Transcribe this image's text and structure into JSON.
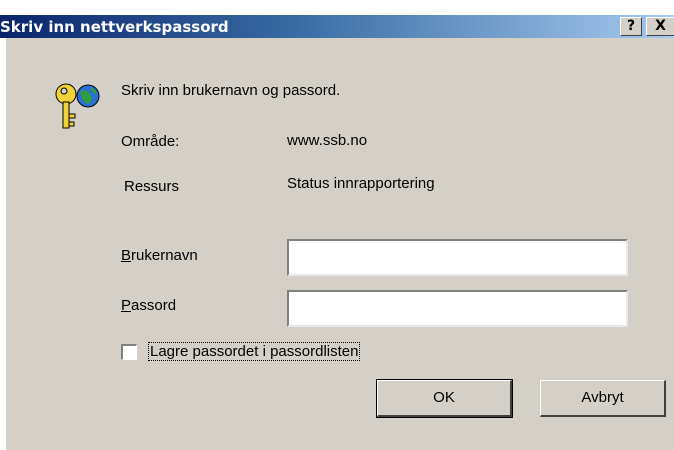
{
  "window": {
    "title": "Skriv inn nettverkspassord",
    "help_button": "?",
    "close_button": "X"
  },
  "prompt": "Skriv inn brukernavn og passord.",
  "area": {
    "label": "Område:",
    "value": "www.ssb.no"
  },
  "resource": {
    "label": "Ressurs",
    "value": "Status innrapportering"
  },
  "username": {
    "label_accel": "B",
    "label_rest": "rukernavn",
    "value": ""
  },
  "password": {
    "label_accel": "P",
    "label_rest": "assord",
    "value": ""
  },
  "save_password": {
    "label": "Lagre passordet i passordlisten",
    "checked": false
  },
  "buttons": {
    "ok": "OK",
    "cancel": "Avbryt"
  },
  "icons": {
    "dialog_icon": "key-globe-icon"
  }
}
